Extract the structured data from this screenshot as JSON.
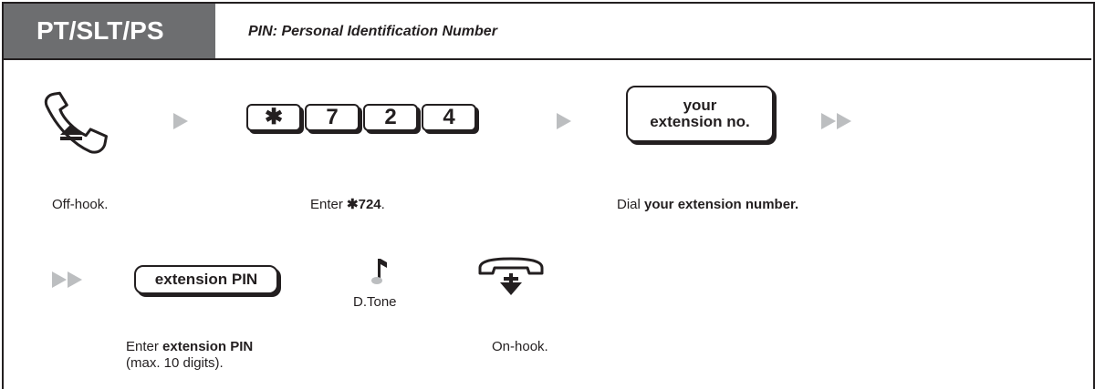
{
  "header": {
    "tab_label": "PT/SLT/PS",
    "subtitle": "PIN: Personal Identification Number"
  },
  "steps": {
    "offhook": {
      "caption": "Off-hook."
    },
    "enter_code": {
      "caption_prefix": "Enter ",
      "caption_bold": "✱724",
      "caption_suffix": ".",
      "keys": [
        "✱",
        "7",
        "2",
        "4"
      ]
    },
    "dial_ext": {
      "key_line1": "your",
      "key_line2": "extension no.",
      "caption_prefix": "Dial ",
      "caption_bold": "your extension number."
    },
    "enter_pin": {
      "key_label": "extension PIN",
      "caption_prefix": "Enter ",
      "caption_bold": "extension PIN",
      "caption_line2": "(max. 10 digits)."
    },
    "tone": {
      "label": "D.Tone"
    },
    "onhook": {
      "caption": "On-hook."
    }
  },
  "colors": {
    "tab_bg": "#6d6e70",
    "arrow": "#bcbec0",
    "text": "#231f20"
  }
}
